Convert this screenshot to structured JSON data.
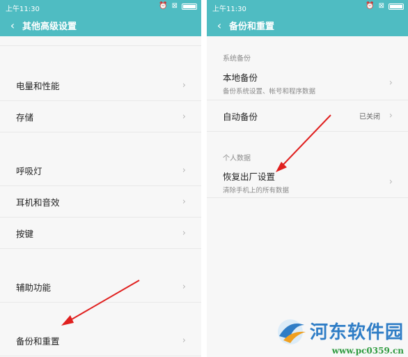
{
  "left": {
    "status_time": "上午11:30",
    "title": "其他高级设置",
    "items": [
      {
        "label": "电量和性能"
      },
      {
        "label": "存储"
      },
      {
        "label": "呼吸灯"
      },
      {
        "label": "耳机和音效"
      },
      {
        "label": "按键"
      },
      {
        "label": "辅助功能"
      },
      {
        "label": "备份和重置"
      }
    ]
  },
  "right": {
    "status_time": "上午11:30",
    "title": "备份和重置",
    "section1": "系统备份",
    "local_backup": {
      "label": "本地备份",
      "sub": "备份系统设置、帐号和程序数据"
    },
    "auto_backup": {
      "label": "自动备份",
      "value": "已关闭"
    },
    "section2": "个人数据",
    "factory_reset": {
      "label": "恢复出厂设置",
      "sub": "清除手机上的所有数据"
    }
  },
  "watermark": {
    "text": "河东软件园",
    "url": "www.pc0359.cn"
  },
  "colors": {
    "titlebar": "#4fbcc2",
    "arrow": "#e0201f"
  },
  "icons": [
    "back-arrow-icon",
    "alarm-icon",
    "close-box-icon",
    "battery-icon",
    "chevron-right-icon"
  ]
}
